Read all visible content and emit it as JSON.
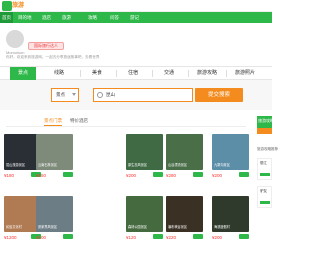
{
  "site": {
    "logo_text": "旅游",
    "brand_color": "#2eb84a",
    "accent_color": "#f38b1f"
  },
  "topnav": {
    "items": [
      {
        "label": "首页"
      },
      {
        "label": "目的地"
      },
      {
        "label": "酒店"
      },
      {
        "label": "旅游"
      },
      {
        "label": "攻略"
      },
      {
        "label": "问答"
      },
      {
        "label": "游记"
      }
    ]
  },
  "user": {
    "name": "Momoison",
    "badge": "国际旅行达人",
    "subtext": "你好，欢迎来到旅游网，一起去分享旅途故事吧，去看世界"
  },
  "menu": {
    "items": [
      {
        "label": "景点"
      },
      {
        "label": "线路"
      },
      {
        "label": "美食"
      },
      {
        "label": "住宿"
      },
      {
        "label": "交通"
      },
      {
        "label": "旅游攻略"
      },
      {
        "label": "旅游照片"
      }
    ]
  },
  "search": {
    "scope": "景点",
    "value": "昆山",
    "button_label": "提交搜索"
  },
  "tabs": {
    "items": [
      {
        "label": "景点门票"
      },
      {
        "label": "特价酒店"
      }
    ]
  },
  "cards": [
    {
      "caption": "昆山旅游景区",
      "price": "¥180",
      "img": "#2a2f36"
    },
    {
      "caption": "云南石林景区",
      "price": "¥150",
      "img": "#7e8a7a"
    },
    {
      "caption": "原生态风景区",
      "price": "¥200",
      "img": "#3f6a43"
    },
    {
      "caption": "山谷漂流景区",
      "price": "¥280",
      "img": "#4a6e48"
    },
    {
      "caption": "九寨沟景区",
      "price": "¥200",
      "img": "#5c8ea8"
    },
    {
      "caption": "民俗文化村",
      "price": "¥1200",
      "img": "#b07a52"
    },
    {
      "caption": "张家界风景区",
      "price": "¥100",
      "img": "#6d7d86"
    },
    {
      "caption": "森林公园景区",
      "price": "¥120",
      "img": "#466a3f"
    },
    {
      "caption": "瀑布峡谷景区",
      "price": "¥220",
      "img": "#3b3024"
    },
    {
      "caption": "海滨度假村",
      "price": "¥200",
      "img": "#2f3a2c"
    }
  ],
  "side": {
    "ad_text": "旅游攻略",
    "label": "旅游攻略推荐",
    "box1": "丽江",
    "box2": "驴友"
  }
}
